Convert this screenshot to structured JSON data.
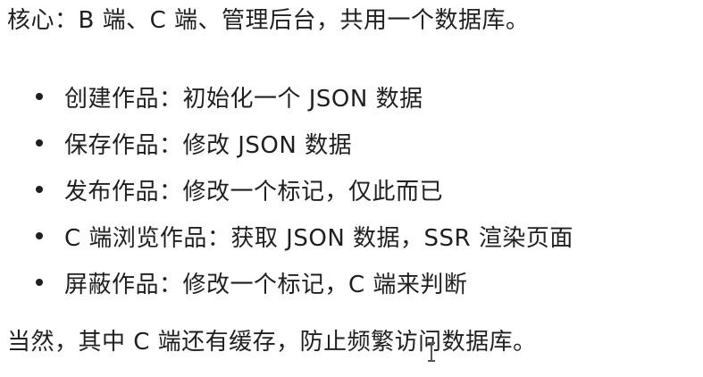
{
  "intro": "核心：B 端、C 端、管理后台，共用一个数据库。",
  "items": [
    "创建作品：初始化一个 JSON 数据",
    "保存作品：修改 JSON 数据",
    "发布作品：修改一个标记，仅此而已",
    "C 端浏览作品：获取 JSON 数据，SSR 渲染页面",
    "屏蔽作品：修改一个标记，C 端来判断"
  ],
  "outro": "当然，其中 C 端还有缓存，防止频繁访问数据库。",
  "cursor_icon": "text-cursor-icon"
}
